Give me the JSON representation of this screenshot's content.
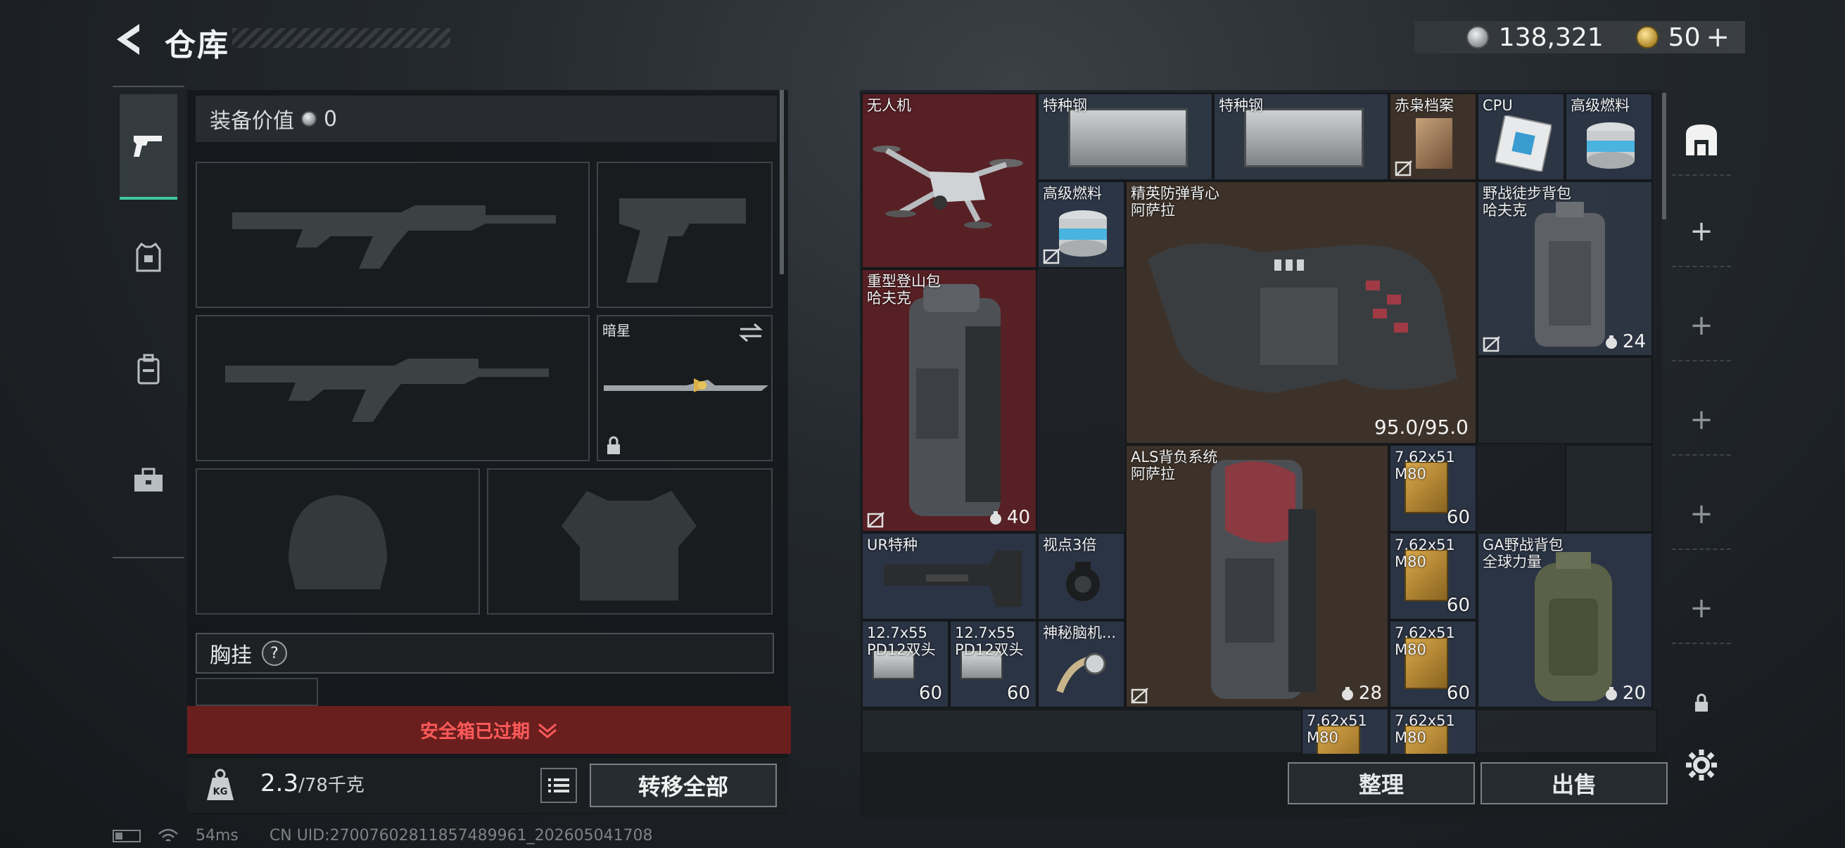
{
  "header": {
    "title": "仓库"
  },
  "currency": {
    "silver": "138,321",
    "gold": "50",
    "gold_plus": "+"
  },
  "left_tabs": [
    "weapon",
    "armor",
    "backpack",
    "toolbox"
  ],
  "equipment": {
    "value_label": "装备价值",
    "value": "0",
    "melee_name": "暗星",
    "chest_label": "胸挂",
    "chest_help": "?",
    "safebox_status": "安全箱已过期",
    "weight": "2.3",
    "weight_max": "/78千克",
    "transfer_all": "转移全部"
  },
  "warehouse": {
    "items": [
      {
        "id": "drone",
        "name": "无人机"
      },
      {
        "id": "steel1",
        "name": "特种钢"
      },
      {
        "id": "steel2",
        "name": "特种钢"
      },
      {
        "id": "files",
        "name": "赤枭档案"
      },
      {
        "id": "cpu",
        "name": "CPU"
      },
      {
        "id": "fuel1",
        "name": "高级燃料"
      },
      {
        "id": "fuel2",
        "name": "高级燃料"
      },
      {
        "id": "vest",
        "name": "精英防弹背心\n阿萨拉",
        "durability": "95.0/95.0"
      },
      {
        "id": "field-pack",
        "name": "野战徒步背包\n哈夫克",
        "capacity": "24"
      },
      {
        "id": "heavy-pack",
        "name": "重型登山包\n哈夫克",
        "capacity": "40"
      },
      {
        "id": "als",
        "name": "ALS背负系统\n阿萨拉",
        "capacity": "28"
      },
      {
        "id": "ammo1",
        "name": "7.62x51\nM80",
        "count": "60"
      },
      {
        "id": "stock",
        "name": "UR特种"
      },
      {
        "id": "scope",
        "name": "视点3倍"
      },
      {
        "id": "ammo2",
        "name": "7.62x51\nM80",
        "count": "60"
      },
      {
        "id": "ga-pack",
        "name": "GA野战背包\n全球力量",
        "capacity": "20"
      },
      {
        "id": "ammo127a",
        "name": "12.7x55\nPD12双头",
        "count": "60"
      },
      {
        "id": "ammo127b",
        "name": "12.7x55\nPD12双头",
        "count": "60"
      },
      {
        "id": "mystery",
        "name": "神秘脑机..."
      },
      {
        "id": "ammo3",
        "name": "7.62x51\nM80",
        "count": "60"
      },
      {
        "id": "ammo4",
        "name": "7.62x51\nM80"
      },
      {
        "id": "ammo5",
        "name": "7.62x51\nM80"
      }
    ],
    "sort_label": "整理",
    "sell_label": "出售"
  },
  "status_bar": {
    "ping": "54ms",
    "uid": "CN UID:270076028118574899​61_202605041708"
  },
  "colors": {
    "accent": "#41c7a1",
    "danger": "#ff5a5a"
  }
}
